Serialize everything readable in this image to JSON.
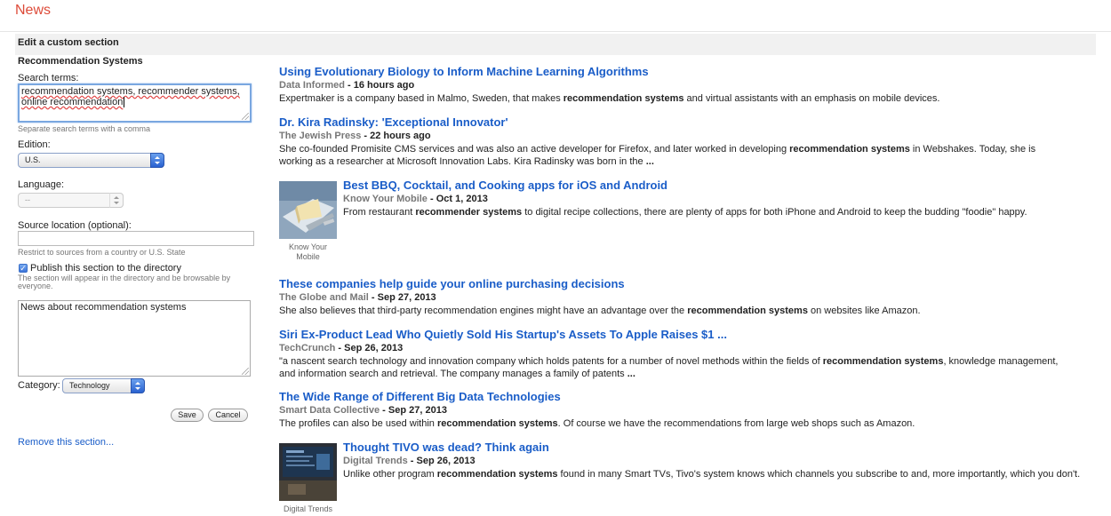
{
  "app": {
    "brand": "News"
  },
  "section_header": "Edit a custom section",
  "form": {
    "section_name": "Recommendation Systems",
    "search_terms_label": "Search terms:",
    "search_terms_line1": "recommendation systems, recommender systems,",
    "search_terms_line2": "online recommendation",
    "search_terms_hint": "Separate search terms with a comma",
    "edition_label": "Edition:",
    "edition_value": "U.S.",
    "language_label": "Language:",
    "language_value": "--",
    "source_location_label": "Source location (optional):",
    "source_location_value": "",
    "source_location_hint": "Restrict to sources from a country or U.S. State",
    "publish_label": "Publish this section to the directory",
    "publish_checked": true,
    "publish_hint": "The section will appear in the directory and be browsable by everyone.",
    "description_value": "News about recommendation systems",
    "category_label": "Category:",
    "category_value": "Technology",
    "save_label": "Save",
    "cancel_label": "Cancel",
    "remove_label": "Remove this section..."
  },
  "articles": [
    {
      "title": "Using Evolutionary Biology to Inform Machine Learning Algorithms",
      "source": "Data Informed",
      "date": " - 16 hours ago",
      "snippet": [
        {
          "t": "Expertmaker is a company based in Malmo, Sweden, that makes "
        },
        {
          "b": "recommendation systems"
        },
        {
          "t": " and virtual assistants with an emphasis on mobile devices."
        }
      ]
    },
    {
      "title": "Dr. Kira Radinsky: 'Exceptional Innovator'",
      "source": "The Jewish Press",
      "date": " - 22 hours ago",
      "snippet": [
        {
          "t": "She co-founded Promisite CMS services and was also an active developer for Firefox, and later worked in developing "
        },
        {
          "b": "recommendation systems"
        },
        {
          "t": " in Webshakes. Today, she is working as a researcher at Microsoft Innovation Labs. Kira Radinsky was born in the "
        },
        {
          "b": "..."
        }
      ]
    },
    {
      "title": "Best BBQ, Cocktail, and Cooking apps for iOS and Android",
      "source": "Know Your Mobile",
      "date": " - Oct 1, 2013",
      "image_caption": "Know Your Mobile",
      "snippet": [
        {
          "t": "From restaurant "
        },
        {
          "b": "recommender systems"
        },
        {
          "t": " to digital recipe collections, there are plenty of apps for both iPhone and Android to keep the budding \"foodie\" happy."
        }
      ]
    },
    {
      "title": "These companies help guide your online purchasing decisions",
      "source": "The Globe and Mail",
      "date": " - Sep 27, 2013",
      "snippet": [
        {
          "t": "She also believes that third-party recommendation engines might have an advantage over the "
        },
        {
          "b": "recommendation systems"
        },
        {
          "t": " on websites like Amazon."
        }
      ]
    },
    {
      "title": "Siri Ex-Product Lead Who Quietly Sold His Startup's Assets To Apple Raises $1 ...",
      "source": "TechCrunch",
      "date": " - Sep 26, 2013",
      "snippet": [
        {
          "t": "\"a nascent search technology and innovation company which holds patents for a number of novel methods within the fields of "
        },
        {
          "b": "recommendation systems"
        },
        {
          "t": ", knowledge management, and information search and retrieval. The company manages a family of patents "
        },
        {
          "b": "..."
        }
      ]
    },
    {
      "title": "The Wide Range of Different Big Data Technologies",
      "source": "Smart Data Collective",
      "date": " - Sep 27, 2013",
      "snippet": [
        {
          "t": "The profiles can also be used within "
        },
        {
          "b": "recommendation systems"
        },
        {
          "t": ". Of course we have the recommendations from large web shops such as Amazon."
        }
      ]
    },
    {
      "title": "Thought TIVO was dead? Think again",
      "source": "Digital Trends",
      "date": " - Sep 26, 2013",
      "image_caption": "Digital Trends",
      "snippet": [
        {
          "t": "Unlike other program "
        },
        {
          "b": "recommendation systems"
        },
        {
          "t": " found in many Smart TVs, Tivo's system knows which channels you subscribe to and, more importantly, which you don't."
        }
      ]
    }
  ]
}
